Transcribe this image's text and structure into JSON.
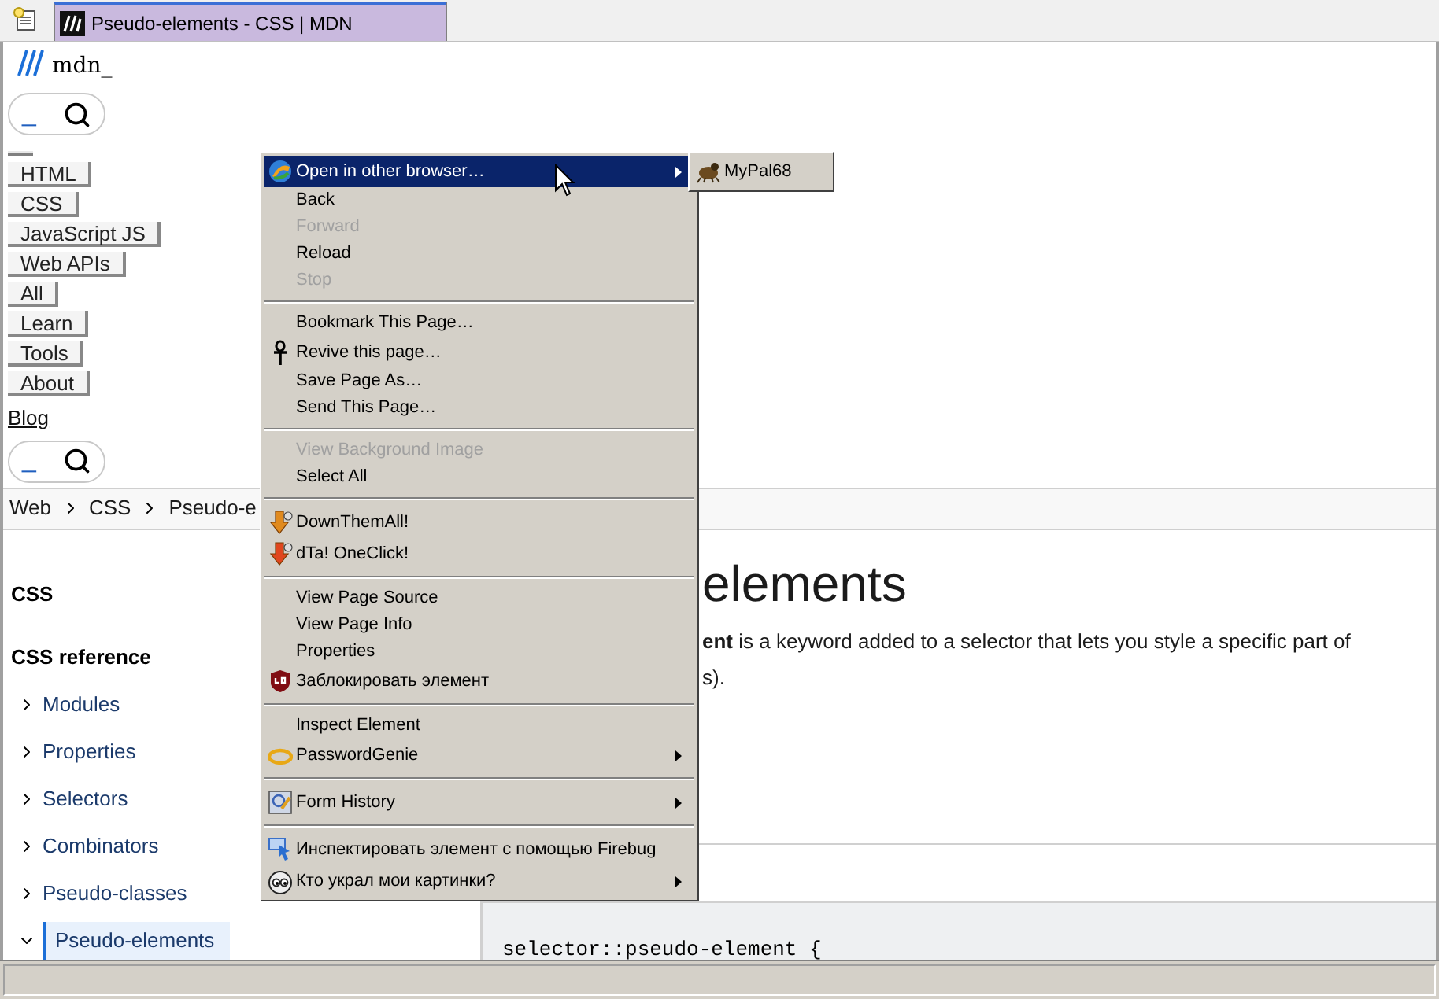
{
  "tab_bar": {
    "tab": {
      "title": "Pseudo-elements - CSS | MDN",
      "selected": true
    }
  },
  "header": {
    "logo_text": "mdn_",
    "search_top": {
      "value": "_"
    },
    "nav": [
      "HTML",
      "CSS",
      "JavaScript JS",
      "Web APIs",
      "All",
      "Learn",
      "Tools",
      "About"
    ],
    "blog_link": "Blog",
    "search_bottom": {
      "value": "_"
    }
  },
  "breadcrumbs": [
    "Web",
    "CSS",
    "Pseudo-e"
  ],
  "sidebar": {
    "title": "CSS",
    "section": "CSS reference",
    "items": [
      {
        "label": "Modules",
        "expanded": false,
        "selected": false
      },
      {
        "label": "Properties",
        "expanded": false,
        "selected": false
      },
      {
        "label": "Selectors",
        "expanded": false,
        "selected": false
      },
      {
        "label": "Combinators",
        "expanded": false,
        "selected": false
      },
      {
        "label": "Pseudo-classes",
        "expanded": false,
        "selected": false
      },
      {
        "label": "Pseudo-elements",
        "expanded": true,
        "selected": true
      }
    ]
  },
  "article": {
    "heading": "elements",
    "intro": [
      "**ent** is a keyword added to a selector that lets you style a specific part of",
      "s)."
    ],
    "code": "selector::pseudo-element {"
  },
  "context_menu": {
    "items": [
      {
        "kind": "item",
        "label": "Open in other browser…",
        "selected": true,
        "disabled": false,
        "submenu": true
      },
      {
        "kind": "item",
        "label": "Back",
        "selected": false,
        "disabled": false,
        "submenu": false
      },
      {
        "kind": "item",
        "label": "Forward",
        "selected": false,
        "disabled": true,
        "submenu": false
      },
      {
        "kind": "item",
        "label": "Reload",
        "selected": false,
        "disabled": false,
        "submenu": false
      },
      {
        "kind": "item",
        "label": "Stop",
        "selected": false,
        "disabled": true,
        "submenu": false
      },
      {
        "kind": "separator"
      },
      {
        "kind": "item",
        "label": "Bookmark This Page…",
        "selected": false,
        "disabled": false,
        "submenu": false
      },
      {
        "kind": "item",
        "label": "Revive this page…",
        "selected": false,
        "disabled": false,
        "submenu": false
      },
      {
        "kind": "item",
        "label": "Save Page As…",
        "selected": false,
        "disabled": false,
        "submenu": false
      },
      {
        "kind": "item",
        "label": "Send This Page…",
        "selected": false,
        "disabled": false,
        "submenu": false
      },
      {
        "kind": "separator"
      },
      {
        "kind": "item",
        "label": "View Background Image",
        "selected": false,
        "disabled": true,
        "submenu": false
      },
      {
        "kind": "item",
        "label": "Select All",
        "selected": false,
        "disabled": false,
        "submenu": false
      },
      {
        "kind": "separator"
      },
      {
        "kind": "item",
        "label": "DownThemAll!",
        "selected": false,
        "disabled": false,
        "submenu": false
      },
      {
        "kind": "item",
        "label": "dTa! OneClick!",
        "selected": false,
        "disabled": false,
        "submenu": false
      },
      {
        "kind": "separator"
      },
      {
        "kind": "item",
        "label": "View Page Source",
        "selected": false,
        "disabled": false,
        "submenu": false
      },
      {
        "kind": "item",
        "label": "View Page Info",
        "selected": false,
        "disabled": false,
        "submenu": false
      },
      {
        "kind": "item",
        "label": "Properties",
        "selected": false,
        "disabled": false,
        "submenu": false
      },
      {
        "kind": "item",
        "label": "Заблокировать элемент",
        "selected": false,
        "disabled": false,
        "submenu": false
      },
      {
        "kind": "separator"
      },
      {
        "kind": "item",
        "label": "Inspect Element",
        "selected": false,
        "disabled": false,
        "submenu": false
      },
      {
        "kind": "item",
        "label": "PasswordGenie",
        "selected": false,
        "disabled": false,
        "submenu": true
      },
      {
        "kind": "separator"
      },
      {
        "kind": "item",
        "label": "Form History",
        "selected": false,
        "disabled": false,
        "submenu": true
      },
      {
        "kind": "separator"
      },
      {
        "kind": "item",
        "label": "Инспектировать элемент с помощью Firebug",
        "selected": false,
        "disabled": false,
        "submenu": false
      },
      {
        "kind": "item",
        "label": "Кто украл мои картинки?",
        "selected": false,
        "disabled": false,
        "submenu": true
      }
    ],
    "submenu": {
      "items": [
        {
          "label": "MyPal68",
          "selected": false
        }
      ]
    }
  }
}
